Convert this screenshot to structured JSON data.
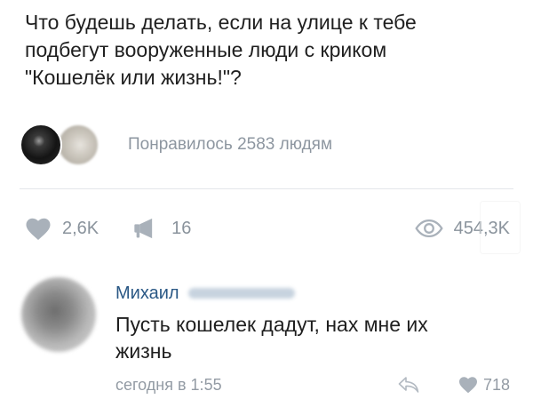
{
  "post": {
    "text_lines": [
      "Что будешь делать, если на улице к тебе",
      "подбегут вооруженные люди с криком",
      "\"Кошелёк или жизнь!\"?"
    ],
    "likers_label": "Понравилось 2583 людям",
    "stats": {
      "likes": "2,6K",
      "reposts": "16",
      "views": "454,3K"
    }
  },
  "comment": {
    "author": "Михаил",
    "text_lines": [
      "Пусть кошелек дадут, нах мне их",
      "жизнь"
    ],
    "time": "сегодня в 1:55",
    "likes": "718"
  },
  "icons": {
    "likes": "heart-icon",
    "reposts": "megaphone-icon",
    "views": "eye-icon",
    "reply": "reply-arrow-icon",
    "comment_like": "heart-icon"
  },
  "colors": {
    "author_link": "#2a5885",
    "muted_text": "#8d96a0",
    "icon_gray": "#a5adb6"
  }
}
